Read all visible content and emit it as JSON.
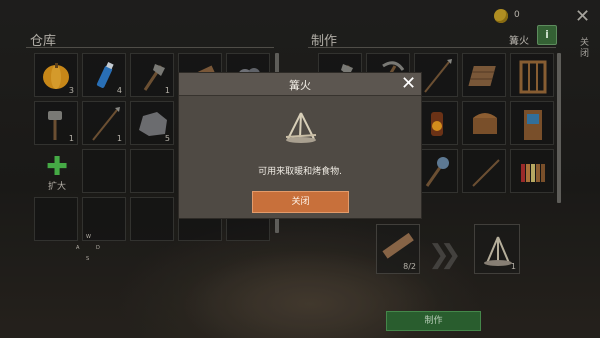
{
  "storage": {
    "title": "仓库",
    "slots": [
      {
        "icon": "pumpkin-icon",
        "count": "3"
      },
      {
        "icon": "water-bottle-icon",
        "count": "4"
      },
      {
        "icon": "stone-axe-icon",
        "count": "1"
      },
      {
        "icon": "wood-plank-icon",
        "count": ""
      },
      {
        "icon": "stone-pile-icon",
        "count": ""
      },
      {
        "icon": "stone-hammer-icon",
        "count": "1"
      },
      {
        "icon": "spear-icon",
        "count": "1"
      },
      {
        "icon": "rock-icon",
        "count": "5"
      }
    ],
    "expand_label": "扩大"
  },
  "compass": {
    "n": "W",
    "w": "A",
    "e": "D",
    "s": "S"
  },
  "craft": {
    "title": "制作",
    "selected_name": "篝火",
    "info_label": "i",
    "recipes": [
      {
        "icon": "stone-axe-icon"
      },
      {
        "icon": "pickaxe-icon"
      },
      {
        "icon": "spear-icon"
      },
      {
        "icon": "wood-raft-icon"
      },
      {
        "icon": "wooden-gate-icon"
      },
      {
        "icon": "torch-icon"
      },
      {
        "icon": "chest-icon"
      },
      {
        "icon": "wooden-door-icon"
      },
      {
        "icon": "mace-icon"
      },
      {
        "icon": "long-spear-icon"
      },
      {
        "icon": "bookshelf-icon"
      }
    ],
    "ingredient": {
      "icon": "wood-plank-icon",
      "count": "8/2"
    },
    "result": {
      "icon": "campfire-icon",
      "count": "1"
    },
    "make_label": "制作"
  },
  "hud": {
    "coins": "0",
    "side_label": "关闭"
  },
  "dialog": {
    "title": "篝火",
    "description": "可用来取暖和烤食物.",
    "close_label": "关闭",
    "icon": "campfire-icon"
  },
  "colors": {
    "dialog_bg": "#4f4a44",
    "close_button": "#c8703b",
    "make_button": "#2f6a35",
    "expand_plus": "#4fc24f"
  }
}
